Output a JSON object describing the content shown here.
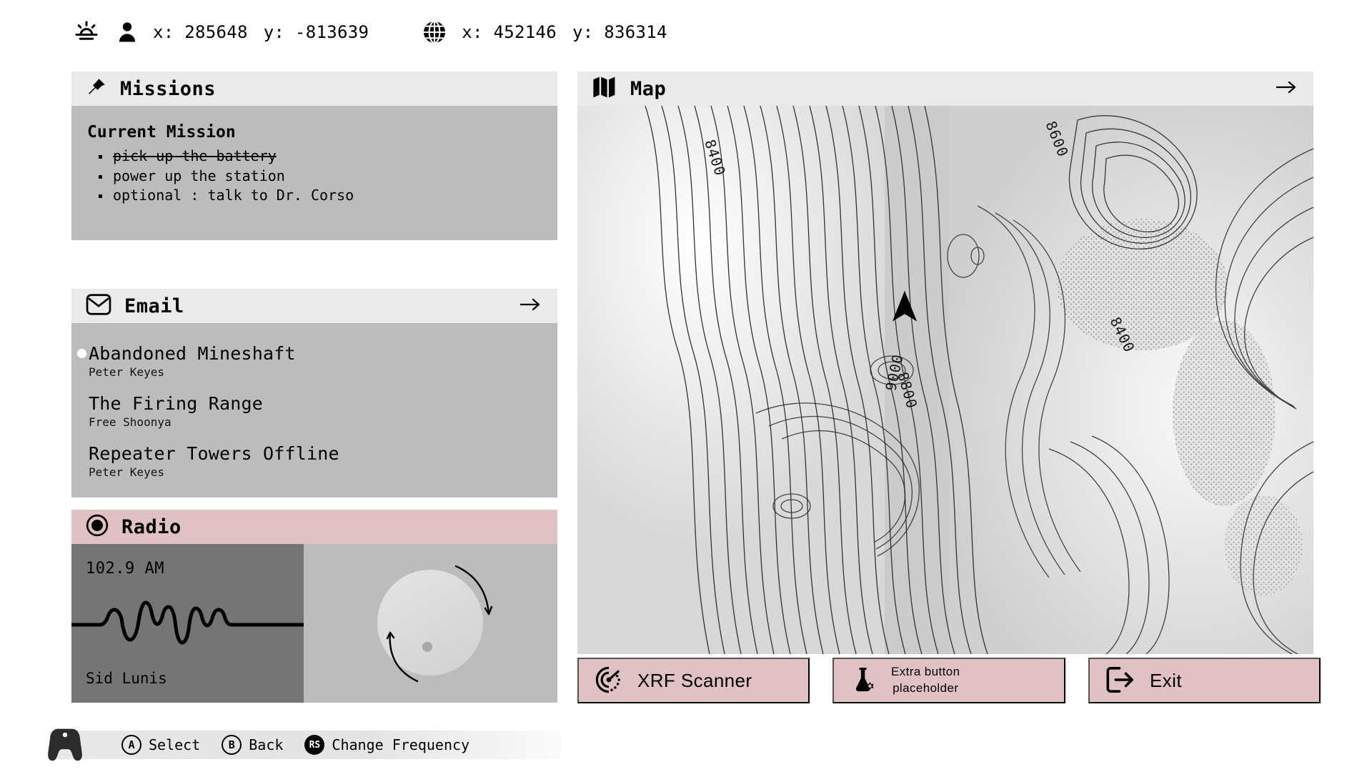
{
  "topbar": {
    "sun_icon": "sunrise-icon",
    "player_icon": "person-icon",
    "player_x": "x: 285648",
    "player_y": "y: -813639",
    "world_icon": "globe-icon",
    "world_x": "x: 452146",
    "world_y": "y: 836314"
  },
  "missions": {
    "icon": "pin-icon",
    "title": "Missions",
    "current_label": "Current Mission",
    "objectives": [
      {
        "text": "pick up the battery",
        "completed": true
      },
      {
        "text": "power up the station",
        "completed": false
      },
      {
        "text": "optional : talk to Dr. Corso",
        "completed": false
      }
    ]
  },
  "email": {
    "icon": "envelope-icon",
    "title": "Email",
    "expand_icon": "arrow-right-icon",
    "messages": [
      {
        "subject": "Abandoned Mineshaft",
        "sender": "Peter Keyes",
        "unread": true
      },
      {
        "subject": "The Firing Range",
        "sender": "Free Shoonya",
        "unread": false
      },
      {
        "subject": "Repeater Towers Offline",
        "sender": "Peter Keyes",
        "unread": false
      }
    ]
  },
  "radio": {
    "icon": "record-icon",
    "title": "Radio",
    "frequency": "102.9 AM",
    "artist": "Sid Lunis",
    "waveform_name": "audio-waveform",
    "knob_name": "frequency-knob"
  },
  "map": {
    "icon": "folded-map-icon",
    "title": "Map",
    "expand_icon": "arrow-right-icon",
    "player_marker": "player-position-marker",
    "contour_labels": [
      "8400",
      "8600",
      "8800",
      "9000",
      "8400"
    ]
  },
  "actions": [
    {
      "id": "xrf-scanner",
      "icon": "radar-scanner-icon",
      "label": "XRF Scanner",
      "multiline": false
    },
    {
      "id": "extra-placeholder",
      "icon": "flask-icon",
      "label": "Extra button\nplaceholder",
      "line1": "Extra button",
      "line2": "placeholder",
      "multiline": true
    },
    {
      "id": "exit",
      "icon": "logout-icon",
      "label": "Exit",
      "multiline": false
    }
  ],
  "controls": {
    "gamepad_icon": "gamepad-icon",
    "hints": [
      {
        "button": "A",
        "style": "outline",
        "label": "Select"
      },
      {
        "button": "B",
        "style": "outline",
        "label": "Back"
      },
      {
        "button": "RS",
        "style": "filled",
        "label": "Change Frequency"
      }
    ]
  },
  "colors": {
    "panel_header": "#eaeaea",
    "panel_body": "#bcbcbc",
    "accent_rose": "#e0c2c4",
    "radio_display": "#757575",
    "background": "#ffffff"
  }
}
